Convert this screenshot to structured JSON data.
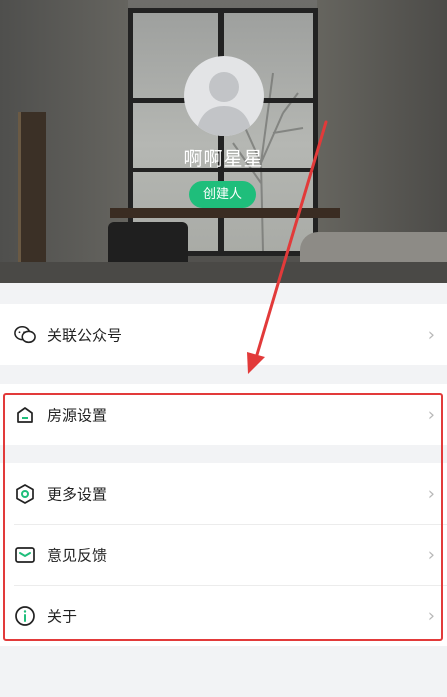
{
  "profile": {
    "username": "啊啊星星",
    "role_badge": "创建人"
  },
  "menu": {
    "group1": [
      {
        "label": "关联公众号",
        "icon": "wechat-official-account-icon"
      }
    ],
    "group2": [
      {
        "label": "房源设置",
        "icon": "house-icon"
      }
    ],
    "group3": [
      {
        "label": "更多设置",
        "icon": "settings-hexagon-icon"
      },
      {
        "label": "意见反馈",
        "icon": "feedback-icon"
      },
      {
        "label": "关于",
        "icon": "info-icon"
      }
    ]
  },
  "colors": {
    "accent_green": "#1fbe7b",
    "annotation_red": "#e23a3a",
    "chevron": "#b8b8b8"
  }
}
